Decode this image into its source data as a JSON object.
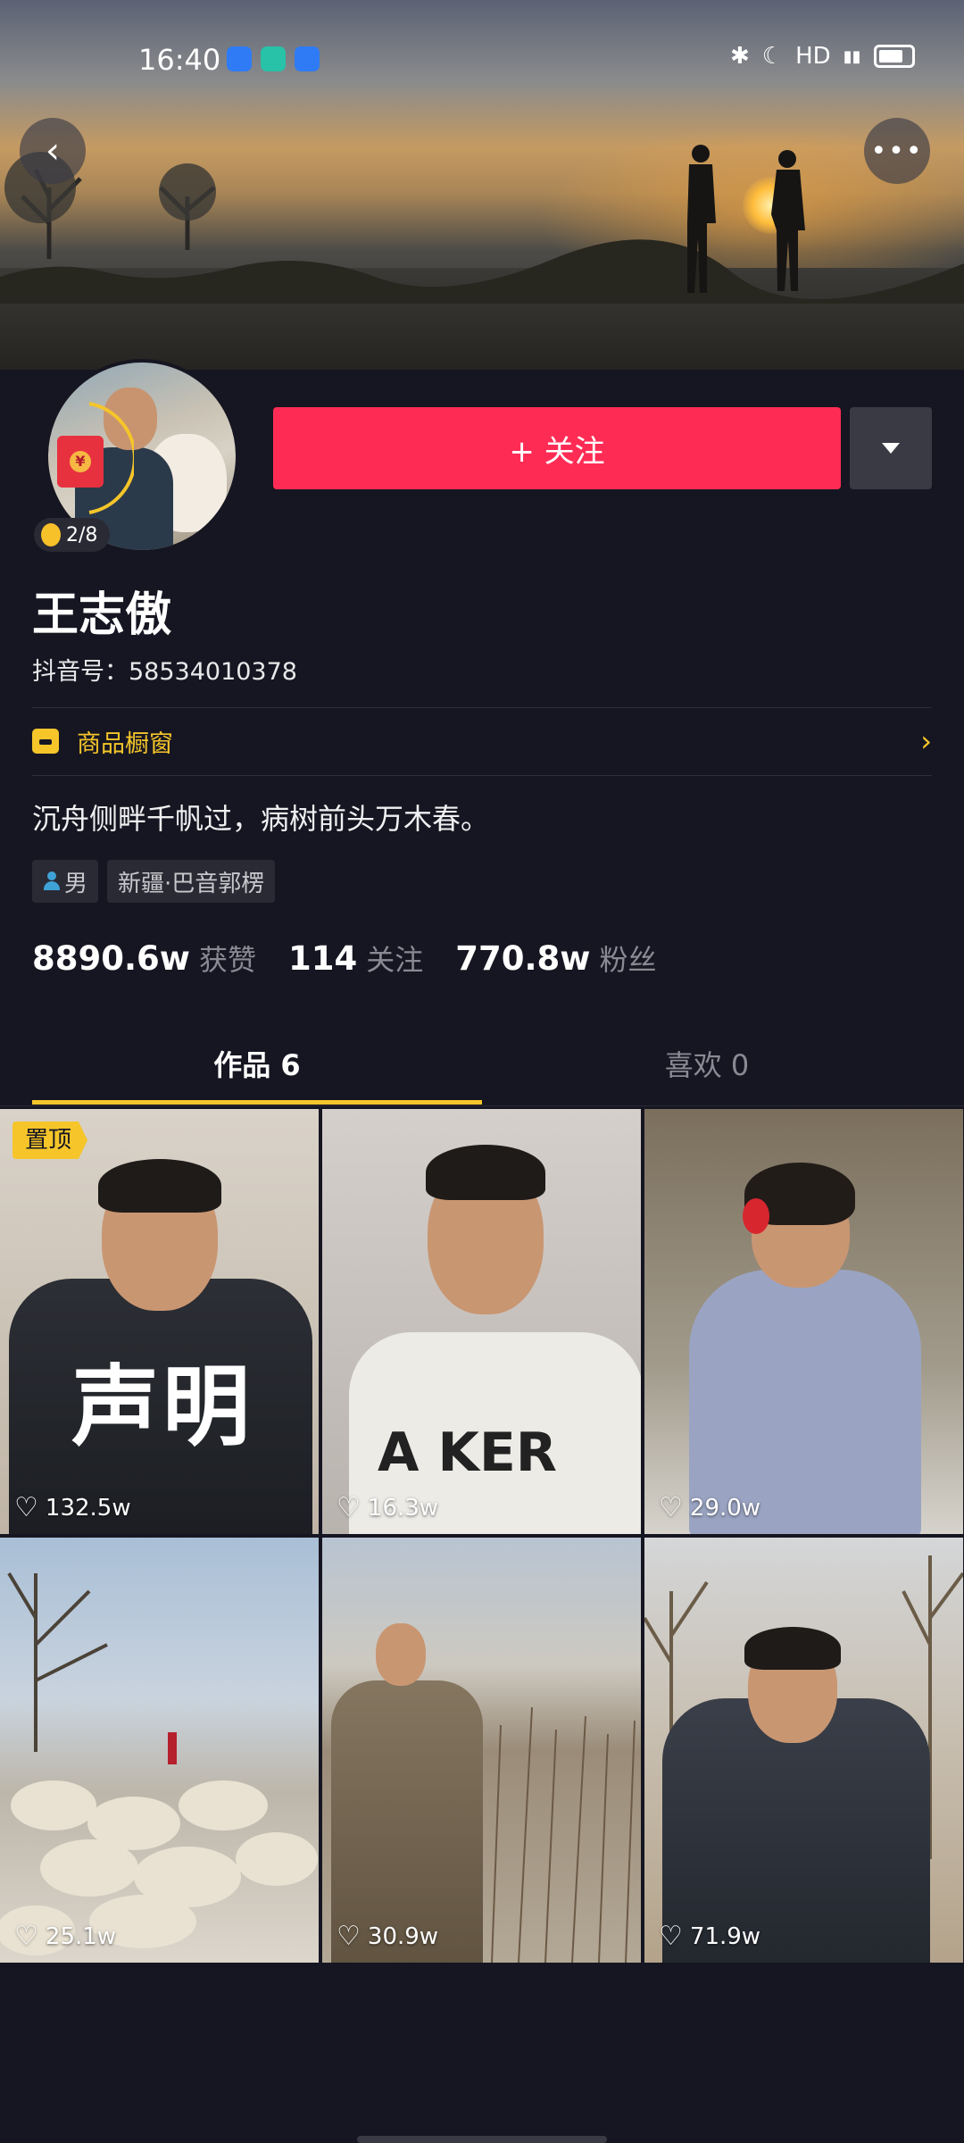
{
  "status_bar": {
    "time": "16:40",
    "network": "HD"
  },
  "profile": {
    "name": "王志傲",
    "douyin_id_label": "抖音号：58534010378",
    "coin_progress": "2/8",
    "follow_label": "+ 关注",
    "shop_label": "商品橱窗",
    "bio": "沉舟侧畔千帆过，病树前头万木春。",
    "tags": [
      {
        "label": "男",
        "icon": "person-icon"
      },
      {
        "label": "新疆·巴音郭楞"
      }
    ],
    "stats": [
      {
        "value": "8890.6w",
        "label": "获赞"
      },
      {
        "value": "114",
        "label": "关注"
      },
      {
        "value": "770.8w",
        "label": "粉丝"
      }
    ]
  },
  "tabs": [
    {
      "label": "作品 6",
      "active": true
    },
    {
      "label": "喜欢 0",
      "active": false
    }
  ],
  "videos": [
    {
      "likes": "132.5w",
      "pinned_label": "置顶",
      "overlay_text": "声明"
    },
    {
      "likes": "16.3w",
      "shirt_text": "A KER"
    },
    {
      "likes": "29.0w"
    },
    {
      "likes": "25.1w"
    },
    {
      "likes": "30.9w"
    },
    {
      "likes": "71.9w"
    }
  ],
  "colors": {
    "background": "#161622",
    "accent_red": "#fe2c55",
    "accent_yellow": "#f5c52a"
  }
}
